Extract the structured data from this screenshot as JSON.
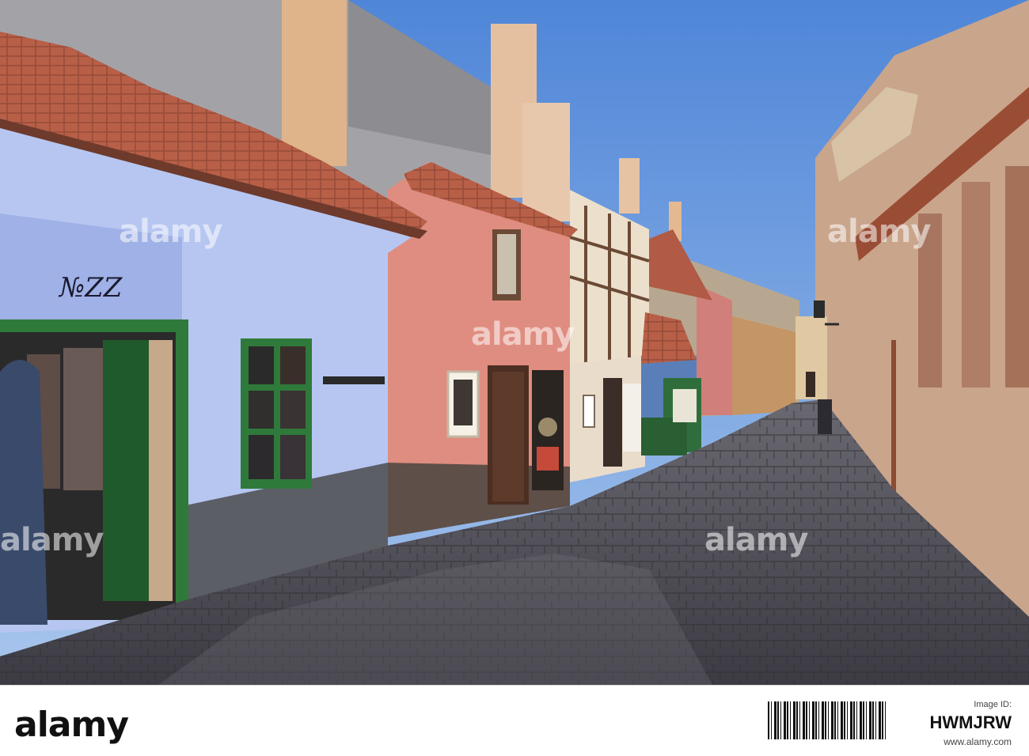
{
  "photo": {
    "house_number": "№ZZ",
    "colors": {
      "sky": "#5d8fd6",
      "blue_house": "#b9c8ef",
      "pink_house": "#d98a7a",
      "roof_tile": "#b4604a",
      "cobblestone": "#4b4a52",
      "window_frame": "#2f7a3a"
    }
  },
  "watermark": {
    "text": "alamy"
  },
  "footer": {
    "logo": "alamy",
    "image_id": "HWMJRW",
    "label": "Image ID:",
    "url": "www.alamy.com"
  }
}
